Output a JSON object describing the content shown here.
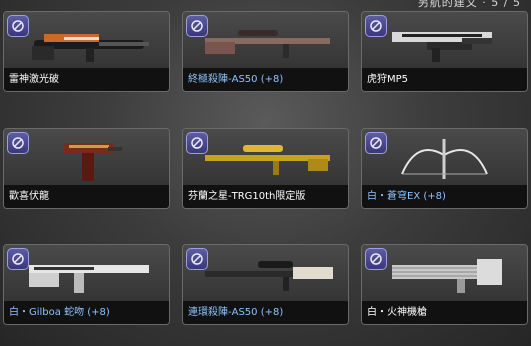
{
  "header": {
    "fragment": "另航的建文 · 5 / 5"
  },
  "colors": {
    "name_white": "#ffffff",
    "name_blue": "#8fc2ff",
    "badge": "#4a4890"
  },
  "items": [
    {
      "name": "雷神激光破",
      "color": "white",
      "icon": "laser-rifle-icon"
    },
    {
      "name": "終極殺陣-AS50 (+8)",
      "color": "blue",
      "icon": "sniper-rifle-icon"
    },
    {
      "name": "虎狩MP5",
      "color": "white",
      "icon": "submachine-gun-icon"
    },
    {
      "name": "歡喜伏龍",
      "color": "white",
      "icon": "machine-pistol-icon"
    },
    {
      "name": "芬蘭之星-TRG10th限定版",
      "color": "white",
      "icon": "gold-sniper-rifle-icon"
    },
    {
      "name": "白・蒼穹EX (+8)",
      "color": "blue",
      "icon": "crossbow-icon"
    },
    {
      "name": "白・Gilboa 蛇吻 (+8)",
      "color": "blue",
      "icon": "double-barrel-rifle-icon"
    },
    {
      "name": "連環殺陣-AS50 (+8)",
      "color": "blue",
      "icon": "sniper-rifle-icon"
    },
    {
      "name": "白・火神機槍",
      "color": "white",
      "icon": "minigun-icon"
    }
  ]
}
